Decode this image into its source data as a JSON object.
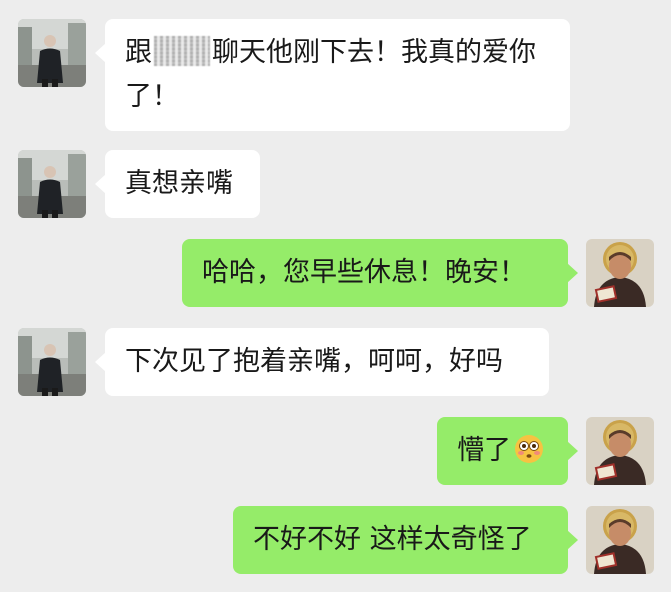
{
  "chat": {
    "colors": {
      "background": "#ededed",
      "incoming_bubble": "#ffffff",
      "outgoing_bubble": "#95ec69",
      "text": "#191919"
    },
    "messages": [
      {
        "direction": "incoming",
        "avatar": "contact-photo-man-in-black-coat",
        "text_before": "跟",
        "redacted": true,
        "text_after": "聊天他刚下去！我真的爱你了！"
      },
      {
        "direction": "incoming",
        "avatar": "contact-photo-man-in-black-coat",
        "text": "真想亲嘴"
      },
      {
        "direction": "outgoing",
        "avatar": "user-photo-painted-saint-with-book",
        "text": "哈哈，您早些休息！晚安！"
      },
      {
        "direction": "incoming",
        "avatar": "contact-photo-man-in-black-coat",
        "text": "下次见了抱着亲嘴，呵呵，好吗"
      },
      {
        "direction": "outgoing",
        "avatar": "user-photo-painted-saint-with-book",
        "text": "懵了",
        "emoji": "flushed-face-emoji"
      },
      {
        "direction": "outgoing",
        "avatar": "user-photo-painted-saint-with-book",
        "text": "不好不好 这样太奇怪了"
      }
    ]
  }
}
